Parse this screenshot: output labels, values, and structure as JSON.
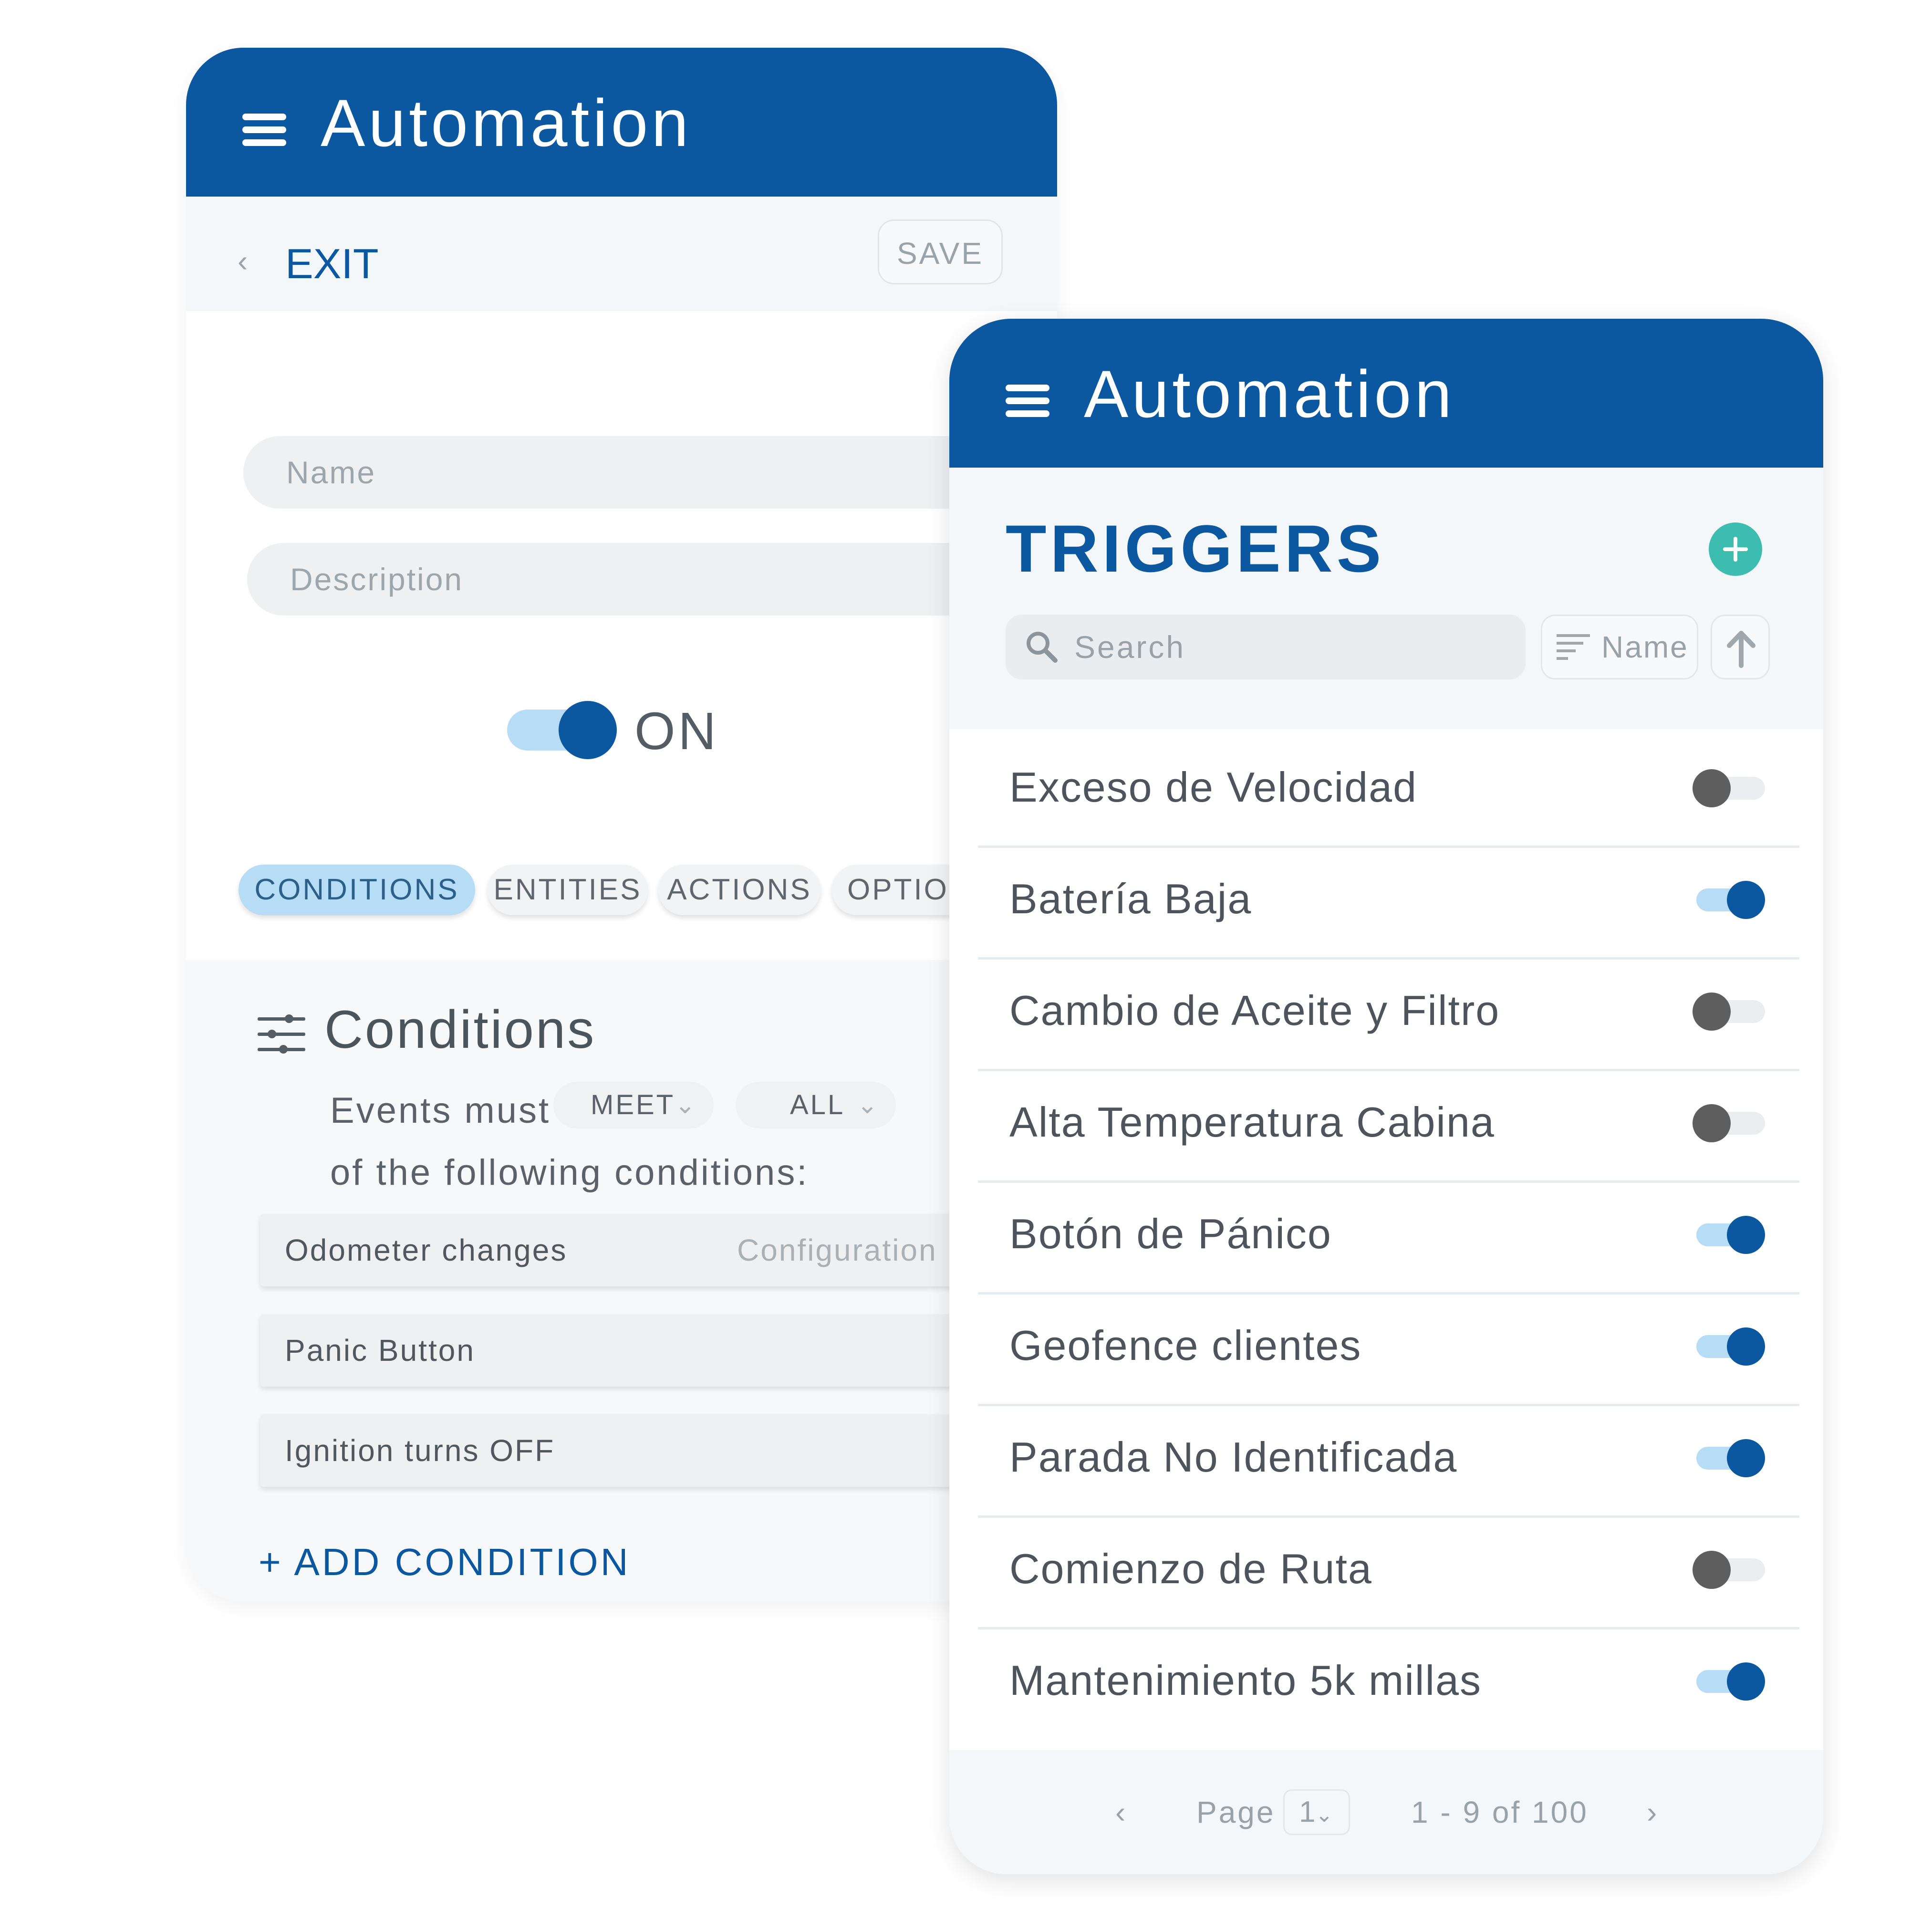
{
  "editor": {
    "header": {
      "title": "Automation",
      "menu_icon": "hamburger-menu-icon"
    },
    "toolbar": {
      "exit_label": "EXIT",
      "save_label": "SAVE"
    },
    "form": {
      "name_placeholder": "Name",
      "description_placeholder": "Description",
      "toggle": {
        "state": "on",
        "label": "ON"
      }
    },
    "tabs": [
      {
        "label": "CONDITIONS",
        "active": true
      },
      {
        "label": "ENTITIES",
        "active": false
      },
      {
        "label": "ACTIONS",
        "active": false
      },
      {
        "label": "OPTION",
        "active": false
      }
    ],
    "conditions": {
      "title": "Conditions",
      "events_must": "Events must",
      "meet_value": "MEET",
      "all_value": "ALL",
      "following": "of the following conditions:",
      "rows": [
        {
          "label": "Odometer changes",
          "config": "Configuration"
        },
        {
          "label": "Panic Button"
        },
        {
          "label": "Ignition turns OFF"
        }
      ],
      "add_label": "+ ADD CONDITION"
    }
  },
  "triggers": {
    "header": {
      "title": "Automation",
      "menu_icon": "hamburger-menu-icon"
    },
    "title": "TRIGGERS",
    "search_placeholder": "Search",
    "sort_label": "Name",
    "items": [
      {
        "label": "Exceso de Velocidad",
        "on": false
      },
      {
        "label": "Batería Baja",
        "on": true
      },
      {
        "label": "Cambio de Aceite y Filtro",
        "on": false
      },
      {
        "label": "Alta Temperatura Cabina",
        "on": false
      },
      {
        "label": "Botón de Pánico",
        "on": true
      },
      {
        "label": "Geofence clientes",
        "on": true
      },
      {
        "label": "Parada No Identificada",
        "on": true
      },
      {
        "label": "Comienzo de Ruta",
        "on": false
      },
      {
        "label": "Mantenimiento 5k millas",
        "on": true
      }
    ],
    "pager": {
      "page_label": "Page",
      "page": "1",
      "range": "1 - 9 of 100"
    }
  },
  "colors": {
    "brand": "#0b58a0",
    "toggle_track_on": "#b7dcf5",
    "add_button": "#3dbdb0",
    "toggle_off_knob": "#5e5e5e"
  }
}
